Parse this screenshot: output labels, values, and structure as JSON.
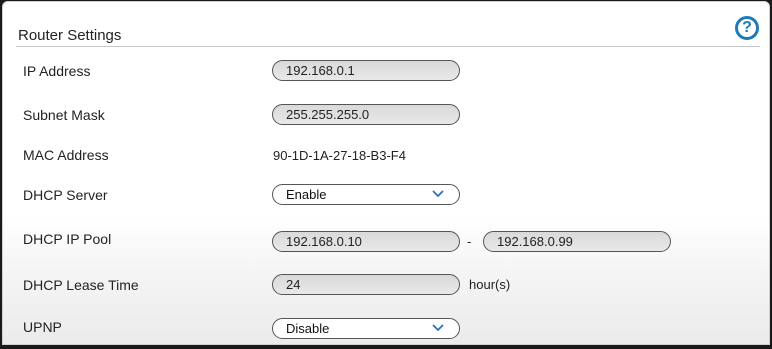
{
  "section_title": "Router Settings",
  "help": {
    "glyph": "?"
  },
  "rows": {
    "ip_address": {
      "label": "IP Address",
      "value": "192.168.0.1"
    },
    "subnet_mask": {
      "label": "Subnet Mask",
      "value": "255.255.255.0"
    },
    "mac_address": {
      "label": "MAC Address",
      "value": "90-1D-1A-27-18-B3-F4"
    },
    "dhcp_server": {
      "label": "DHCP Server",
      "selected": "Enable"
    },
    "dhcp_ip_pool": {
      "label": "DHCP IP Pool",
      "start": "192.168.0.10",
      "separator": "-",
      "end": "192.168.0.99"
    },
    "dhcp_lease_time": {
      "label": "DHCP Lease Time",
      "value": "24",
      "unit": "hour(s)"
    },
    "upnp": {
      "label": "UPNP",
      "selected": "Disable"
    }
  },
  "colors": {
    "accent": "#1f7ab8",
    "chevron": "#2e6fc4"
  }
}
